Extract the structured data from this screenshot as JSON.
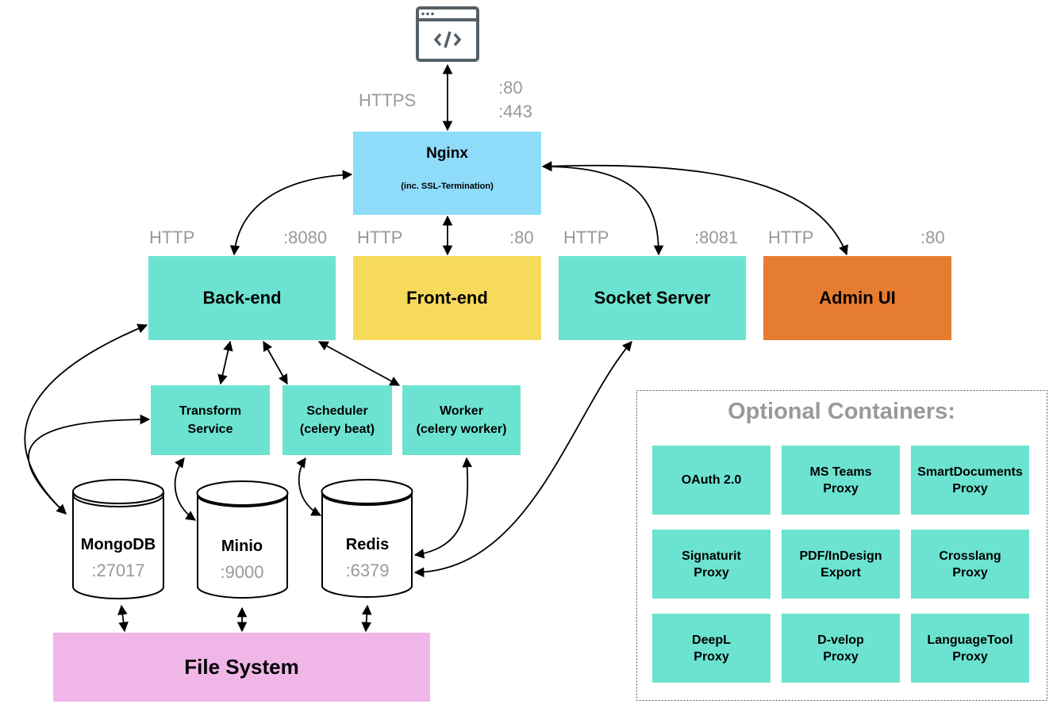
{
  "client": {
    "icon": "browser-code-icon",
    "protocol": "HTTPS",
    "ports": [
      ":80",
      ":443"
    ]
  },
  "nginx": {
    "title": "Nginx",
    "subtitle": "(inc. SSL-Termination)",
    "color": "#8fdbfa"
  },
  "services": [
    {
      "name": "Back-end",
      "protocol": "HTTP",
      "port": ":8080",
      "color": "#6ce3d0"
    },
    {
      "name": "Front-end",
      "protocol": "HTTP",
      "port": ":80",
      "color": "#f8da5b"
    },
    {
      "name": "Socket Server",
      "protocol": "HTTP",
      "port": ":8081",
      "color": "#6ce3d0"
    },
    {
      "name": "Admin UI",
      "protocol": "HTTP",
      "port": ":80",
      "color": "#e67c2f"
    }
  ],
  "workers": [
    {
      "line1": "Transform",
      "line2": "Service"
    },
    {
      "line1": "Scheduler",
      "line2": "(celery beat)"
    },
    {
      "line1": "Worker",
      "line2": "(celery worker)"
    }
  ],
  "databases": [
    {
      "name": "MongoDB",
      "port": ":27017"
    },
    {
      "name": "Minio",
      "port": ":9000"
    },
    {
      "name": "Redis",
      "port": ":6379"
    }
  ],
  "filesystem": {
    "name": "File System",
    "color": "#f1b6e8"
  },
  "optional": {
    "title": "Optional Containers:",
    "items": [
      {
        "line1": "OAuth 2.0",
        "line2": ""
      },
      {
        "line1": "MS Teams",
        "line2": "Proxy"
      },
      {
        "line1": "SmartDocuments",
        "line2": "Proxy"
      },
      {
        "line1": "Signaturit",
        "line2": "Proxy"
      },
      {
        "line1": "PDF/InDesign",
        "line2": "Export"
      },
      {
        "line1": "Crosslang",
        "line2": "Proxy"
      },
      {
        "line1": "DeepL",
        "line2": "Proxy"
      },
      {
        "line1": "D-velop",
        "line2": "Proxy"
      },
      {
        "line1": "LanguageTool",
        "line2": "Proxy"
      }
    ]
  }
}
